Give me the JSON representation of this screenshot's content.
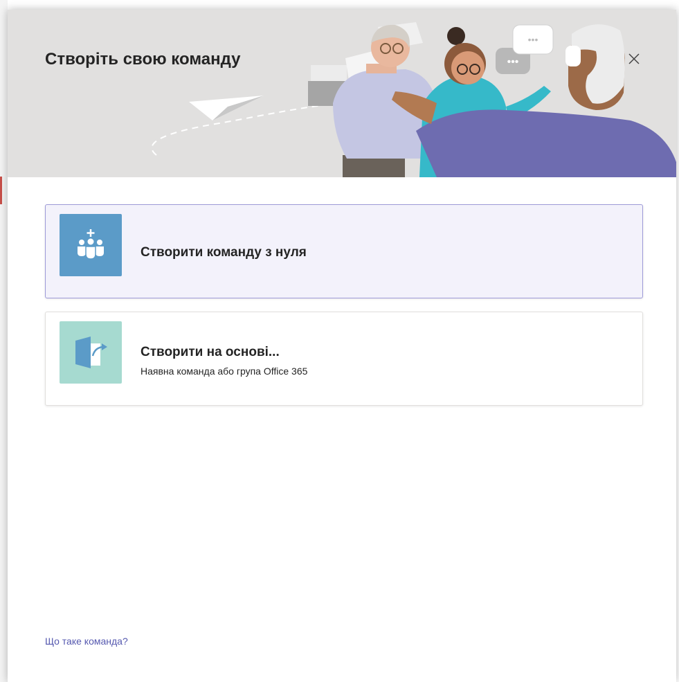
{
  "dialog": {
    "title": "Створіть свою команду",
    "close_icon": "close-icon"
  },
  "options": [
    {
      "title": "Створити команду з нуля",
      "subtitle": "",
      "icon": "team-add-icon",
      "icon_bg": "#5b9bc8",
      "selected": true
    },
    {
      "title": "Створити на основі...",
      "subtitle": "Наявна команда або група Office 365",
      "icon": "create-from-existing-icon",
      "icon_bg": "#a6dad0",
      "selected": false
    }
  ],
  "footer": {
    "help_link": "Що таке команда?"
  },
  "colors": {
    "header_bg": "#e1e0df",
    "selected_bg": "#f3f2fb",
    "selected_border": "#9d9ad8",
    "link": "#5558af"
  }
}
